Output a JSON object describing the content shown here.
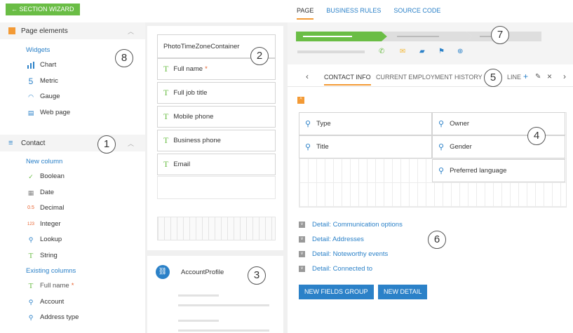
{
  "toolbar": {
    "wizard_label": "← SECTION WIZARD"
  },
  "top_tabs": [
    {
      "label": "PAGE",
      "active": true
    },
    {
      "label": "BUSINESS RULES",
      "active": false
    },
    {
      "label": "SOURCE CODE",
      "active": false
    }
  ],
  "left_panel": {
    "page_elements": {
      "title": "Page elements",
      "sub_title": "Widgets",
      "items": [
        {
          "label": "Chart",
          "icon": "chart-icon"
        },
        {
          "label": "Metric",
          "icon": "metric-icon"
        },
        {
          "label": "Gauge",
          "icon": "gauge-icon"
        },
        {
          "label": "Web page",
          "icon": "web-page-icon"
        }
      ]
    },
    "contact": {
      "title": "Contact",
      "new_title": "New column",
      "new_items": [
        {
          "label": "Boolean",
          "glyph": "✓"
        },
        {
          "label": "Date",
          "glyph": "▦"
        },
        {
          "label": "Decimal",
          "glyph": "0.5"
        },
        {
          "label": "Integer",
          "glyph": "123"
        },
        {
          "label": "Lookup",
          "glyph": "⚲"
        },
        {
          "label": "String",
          "glyph": "T"
        }
      ],
      "existing_title": "Existing columns",
      "existing_items": [
        {
          "label": "Full name",
          "required": "*",
          "glyph": "T"
        },
        {
          "label": "Account",
          "glyph": "⚲"
        },
        {
          "label": "Address type",
          "glyph": "⚲"
        }
      ]
    }
  },
  "middle_panel": {
    "container_title": "PhotoTimeZoneContainer",
    "fields": [
      {
        "label": "Full name",
        "required": "*"
      },
      {
        "label": "Full job title"
      },
      {
        "label": "Mobile phone"
      },
      {
        "label": "Business phone"
      },
      {
        "label": "Email"
      }
    ],
    "account_profile": "AccountProfile"
  },
  "right_panel": {
    "tabs": [
      {
        "label": "CONTACT INFO",
        "active": true
      },
      {
        "label": "CURRENT EMPLOYMENT",
        "active": false
      },
      {
        "label": "HISTORY",
        "active": false
      },
      {
        "label": "LINE",
        "active": false
      }
    ],
    "form_fields": [
      "Type",
      "Owner",
      "Title",
      "Gender",
      "Preferred language"
    ],
    "details": [
      "Detail: Communication options",
      "Detail: Addresses",
      "Detail: Noteworthy events",
      "Detail: Connected to"
    ],
    "buttons": {
      "new_fields_group": "NEW FIELDS GROUP",
      "new_detail": "NEW DETAIL"
    }
  },
  "callouts": [
    "1",
    "2",
    "3",
    "4",
    "5",
    "6",
    "7",
    "8"
  ],
  "colors": {
    "accent_green": "#6abd45",
    "accent_blue": "#2b81c8",
    "accent_orange": "#f39a35"
  }
}
